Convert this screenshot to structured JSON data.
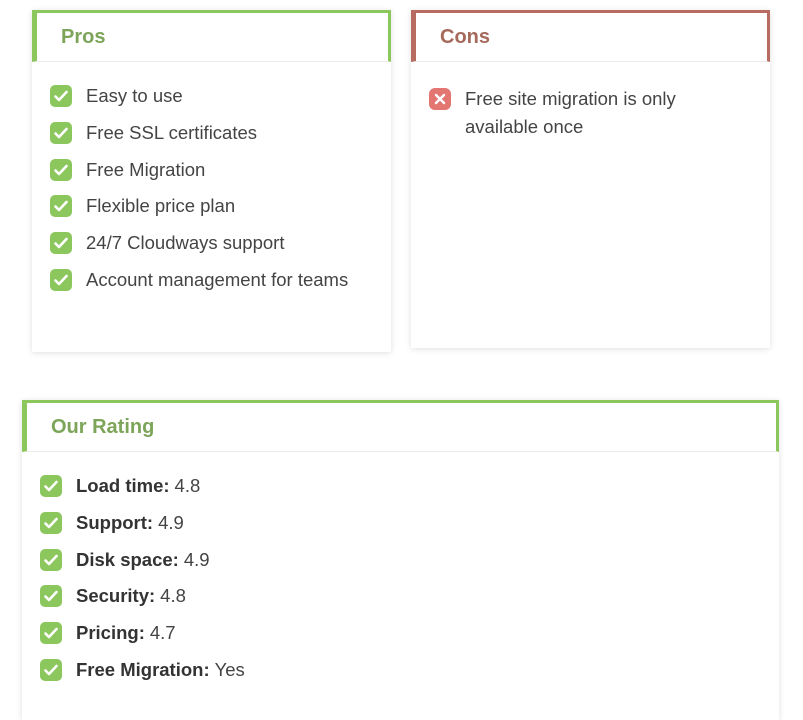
{
  "pros": {
    "title": "Pros",
    "items": [
      "Easy to use",
      "Free SSL certificates",
      "Free Migration",
      "Flexible price plan",
      "24/7 Cloudways support",
      "Account management for teams"
    ]
  },
  "cons": {
    "title": "Cons",
    "items": [
      "Free site migration is only available once"
    ]
  },
  "rating": {
    "title": "Our Rating",
    "items": [
      {
        "label": "Load time:",
        "value": "4.8"
      },
      {
        "label": "Support:",
        "value": "4.9"
      },
      {
        "label": "Disk space:",
        "value": "4.9"
      },
      {
        "label": "Security:",
        "value": "4.8"
      },
      {
        "label": "Pricing:",
        "value": "4.7"
      },
      {
        "label": "Free Migration:",
        "value": "Yes"
      }
    ]
  },
  "colors": {
    "pros_accent": "#8cc75e",
    "cons_accent": "#b86b60",
    "check_icon": "#8cc75e",
    "cross_icon": "#e47672"
  }
}
